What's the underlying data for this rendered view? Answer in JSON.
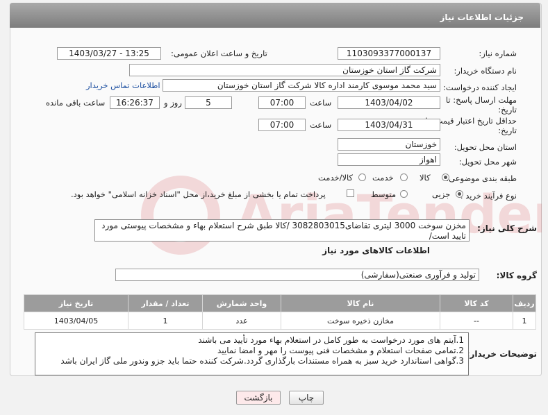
{
  "header": {
    "title": "جزئیات اطلاعات نیاز"
  },
  "form": {
    "need_number_label": "شماره نیاز:",
    "need_number": "1103093377000137",
    "announce_label": "تاریخ و ساعت اعلان عمومی:",
    "announce_value": "1403/03/27 - 13:25",
    "buyer_org_label": "نام دستگاه خریدار:",
    "buyer_org": "شرکت گاز استان خوزستان",
    "creator_label": "ایجاد کننده درخواست:",
    "creator": "سید محمد موسوی کارمند اداره کالا شرکت گاز استان خوزستان",
    "contact_link": "اطلاعات تماس خریدار",
    "deadline_label_1": "مهلت ارسال پاسخ: تا",
    "deadline_label_2": "تاریخ:",
    "deadline_date": "1403/04/02",
    "time_label": "ساعت",
    "deadline_time": "07:00",
    "days_value": "5",
    "days_label": "روز و",
    "remaining_time": "16:26:37",
    "remaining_label": "ساعت باقی مانده",
    "validity_label_1": "حداقل تاریخ اعتبار قیمت: تا",
    "validity_label_2": "تاریخ:",
    "validity_date": "1403/04/31",
    "validity_time": "07:00",
    "province_label": "استان محل تحویل:",
    "province": "خوزستان",
    "city_label": "شهر محل تحویل:",
    "city": "اهواز",
    "category_label": "طبقه بندی موضوعی:",
    "category_options": [
      "کالا",
      "خدمت",
      "کالا/خدمت"
    ],
    "process_label": "نوع فرآیند خرید :",
    "process_options": [
      "جزیی",
      "متوسط"
    ],
    "payment_note": "پرداخت تمام یا بخشی از مبلغ خرید،از محل \"اسناد خزانه اسلامی\" خواهد بود."
  },
  "summary": {
    "label": "شرح کلی نیاز:",
    "text": "مخزن سوخت 3000 لیتری تقاضای3082803015 /کالا طبق شرح استعلام بهاء و مشخصات پیوستی مورد تایید است/"
  },
  "goods_section": {
    "title": "اطلاعات کالاهای مورد نیاز",
    "group_label": "گروه کالا:",
    "group_value": "تولید و فرآوری صنعتی(سفارشی)"
  },
  "table": {
    "headers": [
      "ردیف",
      "کد کالا",
      "نام کالا",
      "واحد شمارش",
      "تعداد / مقدار",
      "تاریخ نیاز"
    ],
    "rows": [
      [
        "1",
        "--",
        "مخازن ذخیره سوخت",
        "عدد",
        "1",
        "1403/04/05"
      ]
    ]
  },
  "buyer_notes": {
    "label": "توضیحات خریدار:",
    "lines": [
      "1.آیتم های مورد درخواست به طور کامل در استعلام بهاء مورد تأیید می باشند",
      "2.تمامی صفحات استعلام و مشخصات فنی پیوست را مهر و امضا نمایید",
      "3.گواهی استاندارد خرید سبز به همراه مستندات بارگذاری گردد.شرکت کننده حتما باید جزو وندور ملی گاز ایران باشد"
    ]
  },
  "buttons": {
    "print": "چاپ",
    "back": "بازگشت"
  },
  "watermark_text": "AriaTender.neT",
  "colors": {
    "header": "#8c8c8c",
    "link": "#1d4fa0",
    "back_button": "#fde9ea"
  }
}
